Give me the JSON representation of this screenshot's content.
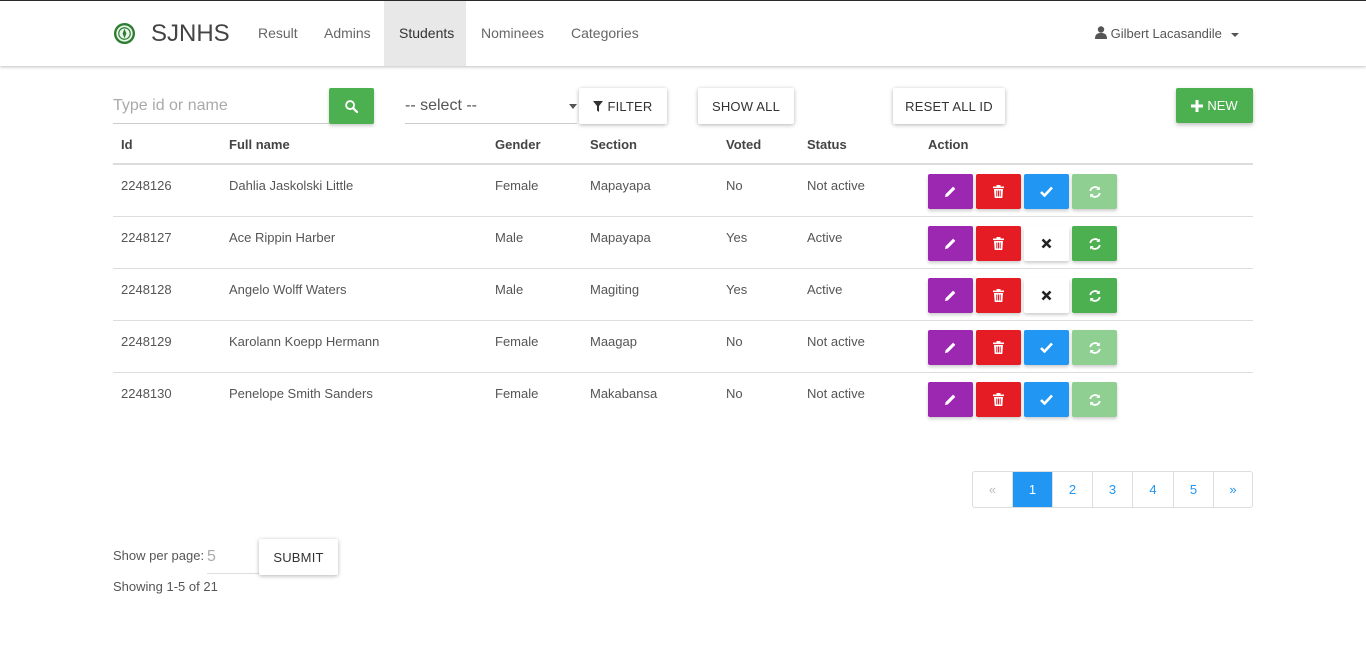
{
  "brand": {
    "name": "SJNHS"
  },
  "nav": {
    "items": [
      {
        "label": "Result"
      },
      {
        "label": "Admins"
      },
      {
        "label": "Students",
        "active": true
      },
      {
        "label": "Nominees"
      },
      {
        "label": "Categories"
      }
    ],
    "user": "Gilbert Lacasandile"
  },
  "toolbar": {
    "search_placeholder": "Type id or name",
    "select_value": "-- select --",
    "filter_label": "FILTER",
    "show_all_label": "SHOW ALL",
    "reset_label": "RESET ALL ID",
    "new_label": "NEW"
  },
  "table": {
    "headers": [
      "Id",
      "Full name",
      "Gender",
      "Section",
      "Voted",
      "Status",
      "Action"
    ],
    "rows": [
      {
        "id": "2248126",
        "name": "Dahlia Jaskolski Little",
        "gender": "Female",
        "section": "Mapayapa",
        "voted": "No",
        "status": "Not active"
      },
      {
        "id": "2248127",
        "name": "Ace Rippin Harber",
        "gender": "Male",
        "section": "Mapayapa",
        "voted": "Yes",
        "status": "Active"
      },
      {
        "id": "2248128",
        "name": "Angelo Wolff Waters",
        "gender": "Male",
        "section": "Magiting",
        "voted": "Yes",
        "status": "Active"
      },
      {
        "id": "2248129",
        "name": "Karolann Koepp Hermann",
        "gender": "Female",
        "section": "Maagap",
        "voted": "No",
        "status": "Not active"
      },
      {
        "id": "2248130",
        "name": "Penelope Smith Sanders",
        "gender": "Female",
        "section": "Makabansa",
        "voted": "No",
        "status": "Not active"
      }
    ]
  },
  "pagination": {
    "prev": "«",
    "pages": [
      "1",
      "2",
      "3",
      "4",
      "5"
    ],
    "current": "1",
    "next": "»"
  },
  "footer": {
    "per_page_label": "Show per page:",
    "per_page_placeholder": "5",
    "submit_label": "SUBMIT",
    "showing": "Showing 1-5 of 21"
  },
  "colors": {
    "green": "#4caf50",
    "purple": "#9c27b0",
    "red": "#e51c23",
    "blue": "#2196f3"
  }
}
